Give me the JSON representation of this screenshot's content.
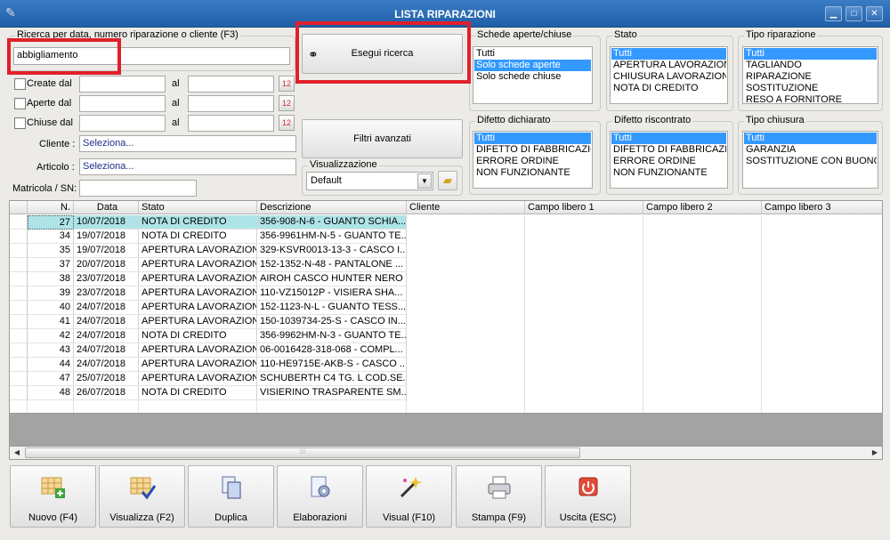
{
  "window": {
    "title": "LISTA RIPARAZIONI"
  },
  "search": {
    "group_label": "Ricerca per data, numero riparazione o cliente (F3)",
    "value": "abbigliamento",
    "button": "Esegui ricerca"
  },
  "dates": {
    "created": "Create dal",
    "opened": "Aperte dal",
    "closed": "Chiuse dal",
    "al": "al"
  },
  "customer": {
    "label": "Cliente :",
    "value": "Seleziona..."
  },
  "article": {
    "label": "Articolo :",
    "value": "Seleziona..."
  },
  "serial": {
    "label": "Matricola / SN:"
  },
  "advanced_filters": "Filtri avanzati",
  "display": {
    "label": "Visualizzazione",
    "value": "Default"
  },
  "filters": {
    "open_closed": {
      "title": "Schede aperte/chiuse",
      "items": [
        "Tutti",
        "Solo schede aperte",
        "Solo schede chiuse"
      ],
      "selected": 1
    },
    "status": {
      "title": "Stato",
      "items": [
        "Tutti",
        "APERTURA LAVORAZIONE",
        "CHIUSURA LAVORAZIONE",
        "NOTA DI CREDITO"
      ],
      "selected": 0
    },
    "repair_type": {
      "title": "Tipo riparazione",
      "items": [
        "Tutti",
        "TAGLIANDO",
        "RIPARAZIONE",
        "SOSTITUZIONE",
        "RESO A FORNITORE"
      ],
      "selected": 0
    },
    "declared_defect": {
      "title": "Difetto dichiarato",
      "items": [
        "Tutti",
        "DIFETTO DI FABBRICAZIONE",
        "ERRORE ORDINE",
        "NON FUNZIONANTE"
      ],
      "selected": 0
    },
    "found_defect": {
      "title": "Difetto riscontrato",
      "items": [
        "Tutti",
        "DIFETTO DI FABBRICAZIONE",
        "ERRORE ORDINE",
        "NON FUNZIONANTE"
      ],
      "selected": 0
    },
    "closure_type": {
      "title": "Tipo chiusura",
      "items": [
        "Tutti",
        "GARANZIA",
        "SOSTITUZIONE CON BUONO ACQUISTO"
      ],
      "selected": 0
    }
  },
  "table": {
    "columns": [
      "N.",
      "Data",
      "Stato",
      "Descrizione",
      "Cliente",
      "Campo libero 1",
      "Campo libero 2",
      "Campo libero 3"
    ],
    "rows": [
      {
        "n": "27",
        "date": "10/07/2018",
        "status": "NOTA DI CREDITO",
        "desc": "356-908-N-6 - GUANTO SCHIA..."
      },
      {
        "n": "34",
        "date": "19/07/2018",
        "status": "NOTA DI CREDITO",
        "desc": "356-9961HM-N-5 - GUANTO TE..."
      },
      {
        "n": "35",
        "date": "19/07/2018",
        "status": "APERTURA LAVORAZIONE",
        "desc": "329-KSVR0013-13-3 - CASCO I..."
      },
      {
        "n": "37",
        "date": "20/07/2018",
        "status": "APERTURA LAVORAZIONE",
        "desc": "152-1352-N-48 - PANTALONE ..."
      },
      {
        "n": "38",
        "date": "23/07/2018",
        "status": "APERTURA LAVORAZIONE",
        "desc": "AIROH CASCO HUNTER NERO ..."
      },
      {
        "n": "39",
        "date": "23/07/2018",
        "status": "APERTURA LAVORAZIONE",
        "desc": "110-VZ15012P - VISIERA SHA..."
      },
      {
        "n": "40",
        "date": "24/07/2018",
        "status": "APERTURA LAVORAZIONE",
        "desc": "152-1123-N-L - GUANTO TESS..."
      },
      {
        "n": "41",
        "date": "24/07/2018",
        "status": "APERTURA LAVORAZIONE",
        "desc": "150-1039734-25-S - CASCO IN..."
      },
      {
        "n": "42",
        "date": "24/07/2018",
        "status": "NOTA DI CREDITO",
        "desc": "356-9962HM-N-3 - GUANTO TE..."
      },
      {
        "n": "43",
        "date": "24/07/2018",
        "status": "APERTURA LAVORAZIONE",
        "desc": "06-0016428-318-068 - COMPL..."
      },
      {
        "n": "44",
        "date": "24/07/2018",
        "status": "APERTURA LAVORAZIONE",
        "desc": "110-HE9715E-AKB-S - CASCO ..."
      },
      {
        "n": "47",
        "date": "25/07/2018",
        "status": "APERTURA LAVORAZIONE",
        "desc": "SCHUBERTH C4 TG. L COD.SE..."
      },
      {
        "n": "48",
        "date": "26/07/2018",
        "status": "NOTA DI CREDITO",
        "desc": "VISIERINO TRASPARENTE SM..."
      }
    ]
  },
  "toolbar": {
    "new": "Nuovo (F4)",
    "view": "Visualizza (F2)",
    "duplicate": "Duplica",
    "process": "Elaborazioni",
    "visual": "Visual (F10)",
    "print": "Stampa (F9)",
    "exit": "Uscita (ESC)"
  },
  "colors": {
    "titlebar": "#2a6db5",
    "selection": "#3399ff",
    "highlight_row": "#aee4e8",
    "annotation_red": "#e0202a"
  }
}
